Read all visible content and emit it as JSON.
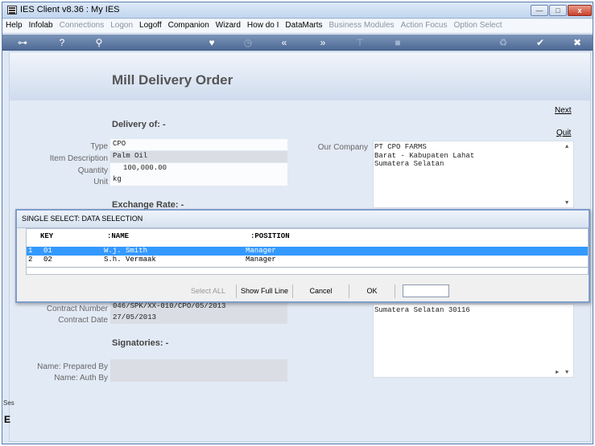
{
  "window": {
    "title": "IES Client v8.36 : My IES",
    "minimize": "—",
    "maximize": "□",
    "close": "x"
  },
  "menu": [
    {
      "label": "Help",
      "enabled": true
    },
    {
      "label": "Infolab",
      "enabled": true
    },
    {
      "label": "Connections",
      "enabled": false
    },
    {
      "label": "Logon",
      "enabled": false
    },
    {
      "label": "Logoff",
      "enabled": true
    },
    {
      "label": "Companion",
      "enabled": true
    },
    {
      "label": "Wizard",
      "enabled": true
    },
    {
      "label": "How do I",
      "enabled": true
    },
    {
      "label": "DataMarts",
      "enabled": true
    },
    {
      "label": "Business Modules",
      "enabled": false
    },
    {
      "label": "Action Focus",
      "enabled": false
    },
    {
      "label": "Option Select",
      "enabled": false
    }
  ],
  "toolbar": {
    "key": "⊶",
    "help": "?",
    "search": "⚲",
    "favorite": "♥",
    "clock": "◷",
    "back": "«",
    "forward": "»",
    "pin": "⊤",
    "stop": "■",
    "recycle": "♻",
    "ok": "✔",
    "close": "✖"
  },
  "form": {
    "title": "Mill Delivery Order",
    "delivery_heading": "Delivery of: -",
    "next_link": "Next",
    "quit_link": "Quit",
    "type_label": "Type",
    "type_value": "CPO",
    "item_label": "Item Description",
    "item_value": "Palm Oil",
    "qty_label": "Quantity",
    "qty_value": "100,000.00",
    "unit_label": "Unit",
    "unit_value": "kg",
    "exchange_heading": "Exchange Rate: -",
    "company_label": "Our Company",
    "company_lines": [
      "PT CPO FARMS",
      "Barat - Kabupaten Lahat",
      "Sumatera Selatan"
    ],
    "contract_number_label": "Contract Number",
    "contract_number_value": "046/SPK/XX-010/CPO/05/2013",
    "contract_date_label": "Contract Date",
    "contract_date_value": "27/05/2013",
    "address_partial": "Sumatera Selatan 30116",
    "signatories_heading": "Signatories: -",
    "prepared_label": "Name: Prepared By",
    "auth_label": "Name: Auth By"
  },
  "dialog": {
    "title": "SINGLE SELECT: DATA SELECTION",
    "columns": [
      "KEY",
      ":NAME",
      ":POSITION"
    ],
    "rows": [
      {
        "n": "1",
        "key": "01",
        "name": "W.j. Smith",
        "position": "Manager",
        "selected": true
      },
      {
        "n": "2",
        "key": "02",
        "name": "S.h. Vermaak",
        "position": "Manager",
        "selected": false
      }
    ],
    "select_all": "Select ALL",
    "show_full_line": "Show Full Line",
    "cancel": "Cancel",
    "ok": "OK",
    "input_value": ""
  },
  "side": {
    "text": "Ses",
    "glyph": "E"
  }
}
